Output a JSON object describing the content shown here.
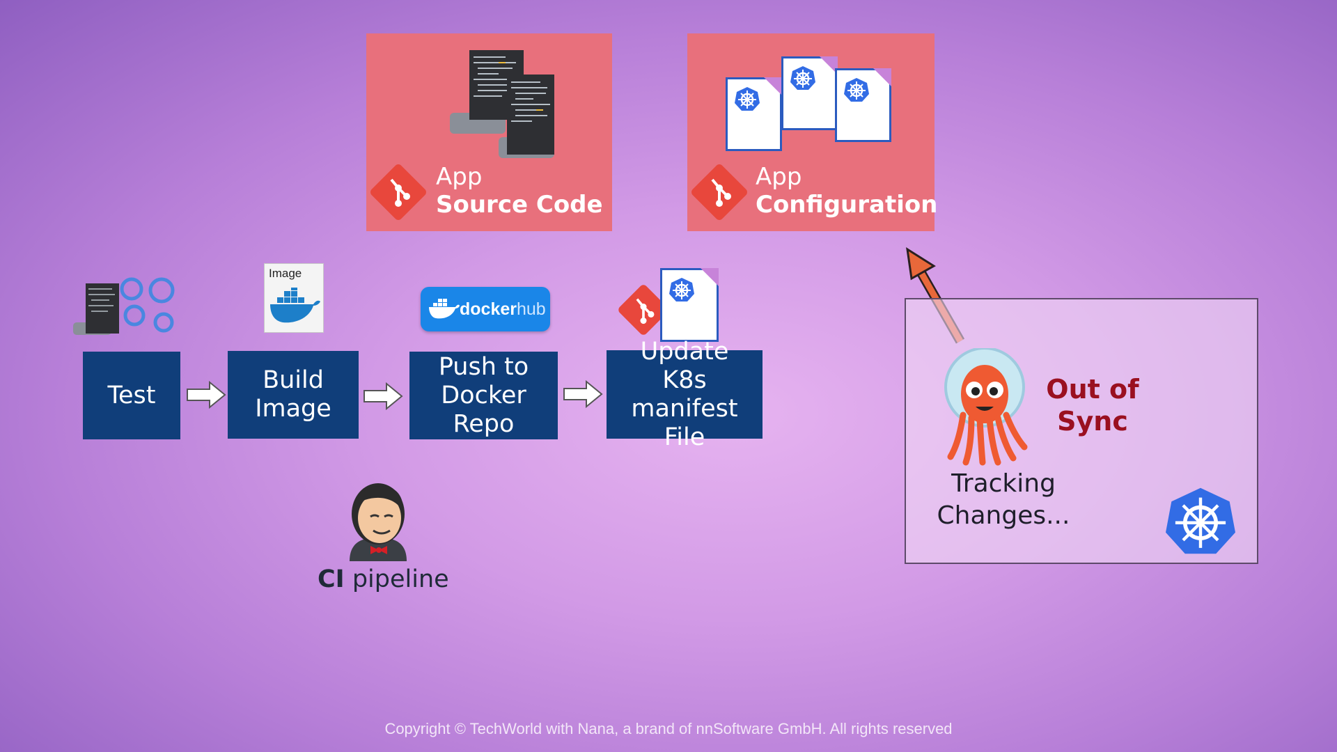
{
  "repos": {
    "source": {
      "line1": "App",
      "line2": "Source Code",
      "icon": "git-icon"
    },
    "config": {
      "line1": "App",
      "line2": "Configuration",
      "icon": "git-icon"
    }
  },
  "pipeline": {
    "steps": [
      {
        "label": "Test"
      },
      {
        "label": "Build\nImage"
      },
      {
        "label": "Push to\nDocker Repo"
      },
      {
        "label": "Update\nK8s manifest\nFile"
      }
    ],
    "image_card_label": "Image",
    "dockerhub_label_a": "docker",
    "dockerhub_label_b": "hub",
    "ci_bold": "CI",
    "ci_rest": " pipeline"
  },
  "argo": {
    "status_line1": "Out of",
    "status_line2": "Sync",
    "tracking_line1": "Tracking",
    "tracking_line2": "Changes..."
  },
  "colors": {
    "repo_box": "#e8707c",
    "step_box": "#103e7a",
    "status_text": "#9a1020",
    "arrow": "#e8683a"
  },
  "copyright": "Copyright © TechWorld with Nana, a brand of nnSoftware GmbH. All rights reserved"
}
